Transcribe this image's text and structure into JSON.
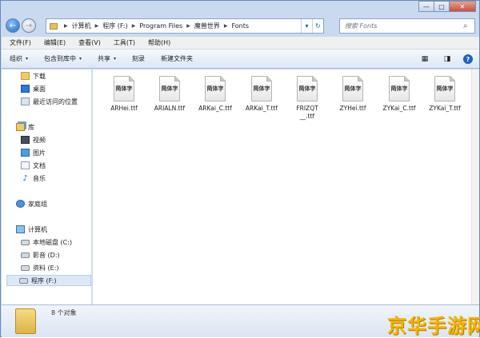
{
  "window": {
    "buttons": {
      "minimize": "—",
      "maximize": "□",
      "close": "✕"
    }
  },
  "nav": {
    "back_glyph": "←",
    "forward_glyph": "→",
    "recent_glyph": "▾",
    "breadcrumb": [
      "计算机",
      "程序 (F:)",
      "Program Files",
      "魔兽世界",
      "Fonts"
    ],
    "dropdown_glyph": "▾",
    "refresh_glyph": "↻",
    "search_placeholder": "搜索 Fonts",
    "search_glyph": "⌕"
  },
  "menu": [
    "文件(F)",
    "编辑(E)",
    "查看(V)",
    "工具(T)",
    "帮助(H)"
  ],
  "toolbar": {
    "organize": "组织",
    "include_library": "包含到库中",
    "share": "共享",
    "burn": "刻录",
    "new_folder": "新建文件夹",
    "dropdown_glyph": "▾",
    "view_glyph": "▦",
    "preview_glyph": "◨",
    "help_glyph": "?"
  },
  "sidebar": {
    "favorites": [
      "下载",
      "桌面",
      "最近访问的位置"
    ],
    "library_title": "库",
    "library_items": [
      "视频",
      "图片",
      "文档",
      "音乐"
    ],
    "music_glyph": "♪",
    "homegroup": "家庭组",
    "computer_title": "计算机",
    "drives": [
      "本地磁盘 (C:)",
      "影音 (D:)",
      "资料 (E:)",
      "程序 (F:)"
    ]
  },
  "files": [
    {
      "name": "ARHei.ttf",
      "preview": "简体字"
    },
    {
      "name": "ARIALN.ttf",
      "preview": "简体字"
    },
    {
      "name": "ARKai_C.ttf",
      "preview": "简体字"
    },
    {
      "name": "ARKai_T.ttf",
      "preview": "简体字"
    },
    {
      "name": "FRIZQT__.ttf",
      "preview": "简体字"
    },
    {
      "name": "ZYHei.ttf",
      "preview": "简体字"
    },
    {
      "name": "ZYKai_C.ttf",
      "preview": "简体字"
    },
    {
      "name": "ZYKai_T.ttf",
      "preview": "简体字"
    }
  ],
  "status": {
    "count": "8 个对象"
  },
  "watermark": "京华手游网"
}
